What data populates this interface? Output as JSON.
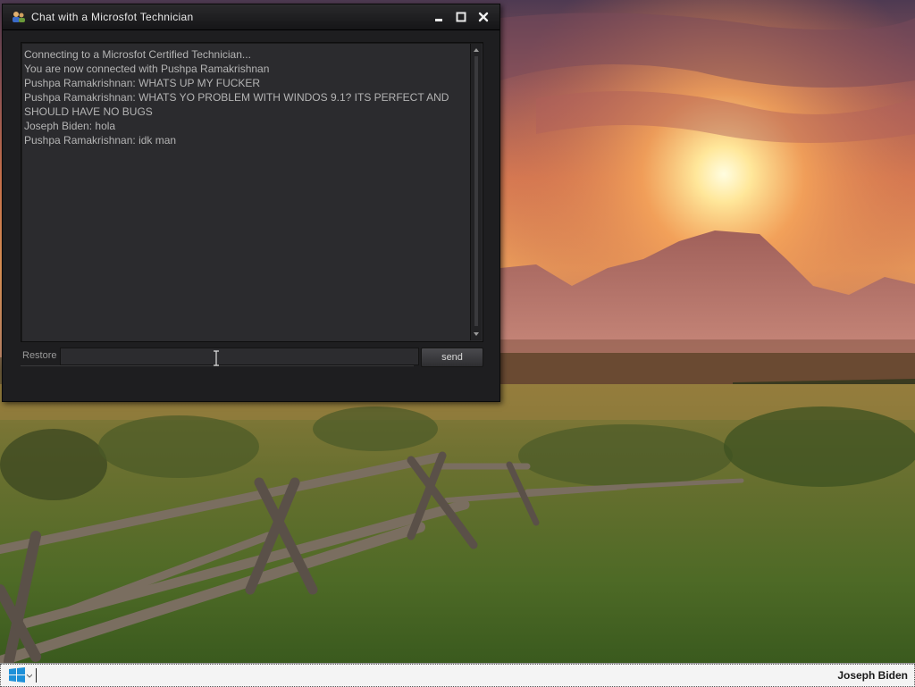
{
  "window": {
    "title": "Chat with a Microsfot Technician"
  },
  "transcript": {
    "lines": [
      "Connecting to a Microsfot Certified Technician...",
      "You are now connected with Pushpa Ramakrishnan",
      "Pushpa Ramakrishnan: WHATS UP MY FUCKER",
      "Pushpa Ramakrishnan: WHATS YO PROBLEM WITH WINDOS 9.1? ITS PERFECT AND SHOULD HAVE NO BUGS",
      "Joseph Biden: hola",
      "Pushpa Ramakrishnan: idk man"
    ]
  },
  "composer": {
    "label": "Restore",
    "input_value": "",
    "send_label": "send"
  },
  "taskbar": {
    "user_name": "Joseph Biden"
  },
  "icons": {
    "window_app": "users-icon",
    "minimize": "minimize-icon",
    "maximize": "maximize-icon",
    "close": "close-icon",
    "start": "windows-logo-icon"
  },
  "colors": {
    "window_bg": "#1e1e20",
    "transcript_bg": "#2b2b2e",
    "text": "#b4b4b4",
    "taskbar_bg": "#f4f4f4",
    "windows_logo": "#1e90d8"
  }
}
